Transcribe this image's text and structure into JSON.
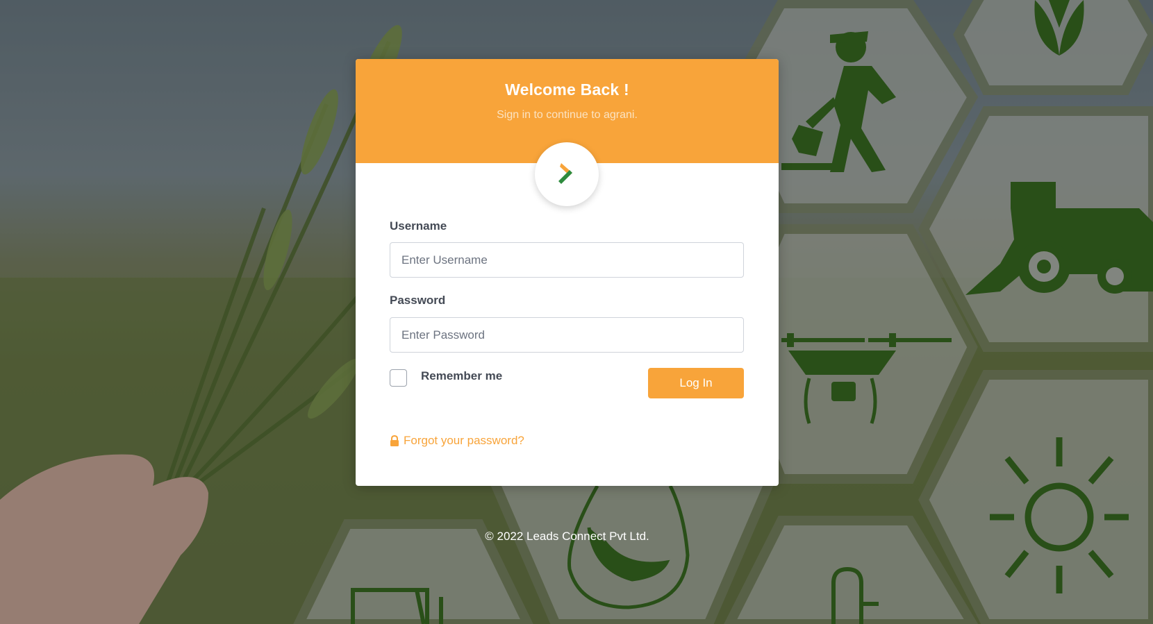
{
  "header": {
    "title": "Welcome Back !",
    "subtitle": "Sign in to continue to agrani."
  },
  "form": {
    "username_label": "Username",
    "username_placeholder": "Enter Username",
    "password_label": "Password",
    "password_placeholder": "Enter Password",
    "remember_label": "Remember me",
    "remember_checked": false,
    "login_label": "Log In",
    "forgot_label": "Forgot your password?"
  },
  "footer": {
    "copyright": "© 2022 Leads Connect Pvt Ltd."
  },
  "colors": {
    "accent": "#f8a43a",
    "icon_green": "#1f5a06",
    "logo_green": "#2e8b3e"
  },
  "icons": [
    "brand-logo-icon",
    "lock-icon",
    "farmer-icon",
    "harvester-icon",
    "drone-icon",
    "sun-icon",
    "plant-icon",
    "water-drop-icon",
    "tractor-icon"
  ]
}
